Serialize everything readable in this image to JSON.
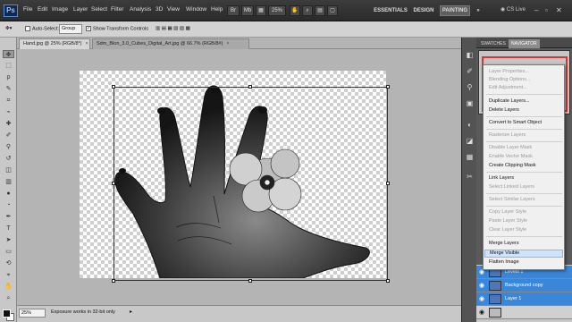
{
  "app": {
    "logo": "Ps"
  },
  "menus": [
    "File",
    "Edit",
    "Image",
    "Layer",
    "Select",
    "Filter",
    "Analysis",
    "3D",
    "View",
    "Window",
    "Help"
  ],
  "menubar": {
    "zoom": "25%",
    "workspaces": [
      "ESSENTIALS",
      "DESIGN",
      "PAINTING"
    ],
    "active_workspace": "PAINTING",
    "more": "»",
    "cs_live": "CS Live"
  },
  "options": {
    "auto_select_label": "Auto-Select:",
    "auto_select_value": "Group",
    "transform_controls_label": "Show Transform Controls"
  },
  "doc_tabs": [
    {
      "title": "Hand.jpg @ 25% (RGB/8*)",
      "close": "×"
    },
    {
      "title": "Sdm_Blon_3.0_Cubes_Digital_Art.jpg @ 66.7% (RGB/8#)",
      "close": "×"
    }
  ],
  "right_panel": {
    "tabs": [
      "SWATCHES",
      "NAVIGATOR"
    ]
  },
  "context_menu": [
    {
      "label": "Layer Properties...",
      "enabled": false
    },
    {
      "label": "Blending Options...",
      "enabled": false
    },
    {
      "label": "Edit Adjustment...",
      "enabled": false
    },
    {
      "label": "Duplicate Layers...",
      "enabled": true
    },
    {
      "label": "Delete Layers",
      "enabled": true
    },
    {
      "label": "Convert to Smart Object",
      "enabled": true
    },
    {
      "label": "Rasterize Layers",
      "enabled": false
    },
    {
      "label": "Disable Layer Mask",
      "enabled": false
    },
    {
      "label": "Enable Vector Mask",
      "enabled": false
    },
    {
      "label": "Create Clipping Mask",
      "enabled": true
    },
    {
      "label": "Link Layers",
      "enabled": true
    },
    {
      "label": "Select Linked Layers",
      "enabled": false
    },
    {
      "label": "Select Similar Layers",
      "enabled": false
    },
    {
      "label": "Copy Layer Style",
      "enabled": false
    },
    {
      "label": "Paste Layer Style",
      "enabled": false
    },
    {
      "label": "Clear Layer Style",
      "enabled": false
    },
    {
      "label": "Merge Layers",
      "enabled": true
    },
    {
      "label": "Merge Visible",
      "enabled": true,
      "highlighted": true
    },
    {
      "label": "Flatten Image",
      "enabled": true
    }
  ],
  "layers": [
    {
      "name": "Levels 1",
      "selected": true
    },
    {
      "name": "Background copy",
      "selected": true
    },
    {
      "name": "Layer 1",
      "selected": true
    },
    {
      "name": "",
      "selected": false
    }
  ],
  "status": {
    "zoom": "25%",
    "message": "Exposure works in 32-bit only",
    "arrow": "▸"
  },
  "colors": {
    "accent": "#3a86d8",
    "highlight": "#cfe3fb",
    "canvas_bg": "#b4b4b4"
  }
}
